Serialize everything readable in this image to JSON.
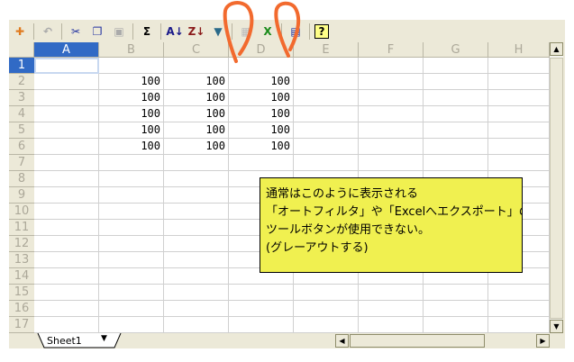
{
  "toolbar": {
    "buttons": [
      {
        "name": "office-assistant-icon",
        "glyph": "✚",
        "color": "#e07b20"
      },
      {
        "name": "undo-icon",
        "glyph": "↶",
        "color": "#aaa"
      },
      {
        "name": "cut-icon",
        "glyph": "✂",
        "color": "#2030a0"
      },
      {
        "name": "copy-icon",
        "glyph": "❐",
        "color": "#2030a0"
      },
      {
        "name": "paste-icon",
        "glyph": "▣",
        "color": "#aaa"
      },
      {
        "name": "autosum-icon",
        "glyph": "Σ",
        "color": "#000"
      },
      {
        "name": "sort-ascending-icon",
        "glyph": "A↓",
        "color": "#1a1a8a"
      },
      {
        "name": "sort-descending-icon",
        "glyph": "Z↓",
        "color": "#8a1a1a"
      },
      {
        "name": "autofilter-icon",
        "glyph": "▼",
        "color": "#2a6a8a"
      },
      {
        "name": "pivot-table-icon",
        "glyph": "▦",
        "color": "#bbb"
      },
      {
        "name": "export-to-excel-icon",
        "glyph": "X",
        "color": "#1a8a1a"
      },
      {
        "name": "properties-icon",
        "glyph": "▤",
        "color": "#2030a0"
      },
      {
        "name": "help-icon",
        "glyph": "?",
        "color": "#000"
      }
    ]
  },
  "columns": [
    "A",
    "B",
    "C",
    "D",
    "E",
    "F",
    "G",
    "H"
  ],
  "rows": [
    "1",
    "2",
    "3",
    "4",
    "5",
    "6",
    "7",
    "8",
    "9",
    "10",
    "11",
    "12",
    "13",
    "14",
    "15",
    "16",
    "17"
  ],
  "cells": {
    "B": [
      "",
      "100",
      "100",
      "100",
      "100",
      "100"
    ],
    "C": [
      "",
      "100",
      "100",
      "100",
      "100",
      "100"
    ],
    "D": [
      "",
      "100",
      "100",
      "100",
      "100",
      "100"
    ]
  },
  "comment": {
    "lines": [
      "通常はこのように表示される",
      "「オートフィルタ」や「Excelへエクスポート」の",
      "ツールボタンが使用できない。",
      "(グレーアウトする)"
    ],
    "background": "#f0f050"
  },
  "sheet_tab": "Sheet1",
  "annotation_color": "#f26a2e"
}
